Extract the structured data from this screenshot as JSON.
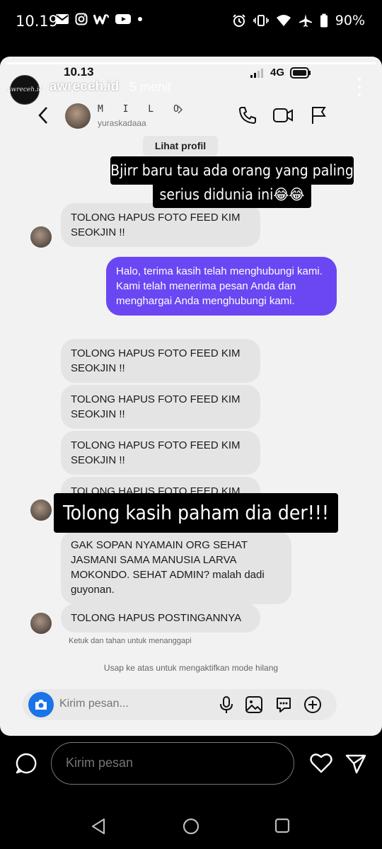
{
  "phone_status": {
    "time": "10.19",
    "battery": "90%"
  },
  "story": {
    "username": "awreceh.id",
    "time_ago": "5 menit",
    "avatar_text": "Awreceh.id"
  },
  "inner_status": {
    "time": "10.13",
    "network": "4G"
  },
  "chat_header": {
    "name": "M I L O",
    "handle": "yuraskadaaa",
    "view_profile": "Lihat profil"
  },
  "messages": [
    {
      "text": "TOLONG HAPUS FOTO FEED KIM SEOKJIN !!"
    },
    {
      "text": "Halo, terima kasih telah menghubungi kami. Kami telah menerima pesan Anda dan menghargai Anda menghubungi kami."
    },
    {
      "text": "TOLONG HAPUS FOTO FEED KIM SEOKJIN !!"
    },
    {
      "text": "TOLONG HAPUS FOTO FEED KIM SEOKJIN !!"
    },
    {
      "text": "TOLONG HAPUS FOTO FEED KIM SEOKJIN !!"
    },
    {
      "text": "TOLONG HAPUS FOTO FEED KIM"
    },
    {
      "text": "GAK SOPAN NYAMAIN ORG SEHAT JASMANI SAMA MANUSIA LARVA MOKONDO. SEHAT ADMIN? malah dadi guyonan."
    },
    {
      "text": "TOLONG HAPUS POSTINGANNYA"
    }
  ],
  "overlays": {
    "top_line1": "Bjirr baru tau ada orang yang paling",
    "top_line2": "serius didunia ini😂😂",
    "middle": "Tolong kasih paham dia der!!!"
  },
  "hints": {
    "tap_hold": "Ketuk dan tahan untuk menanggapi",
    "swipe_up": "Usap ke atas untuk mengaktifkan mode hilang"
  },
  "composer": {
    "placeholder": "Kirim pesan..."
  },
  "reply": {
    "placeholder": "Kirim pesan"
  },
  "colors": {
    "sent_bubble": "#6a47f2",
    "received_bubble": "#e4e4e4",
    "camera_button": "#1a73e8"
  }
}
